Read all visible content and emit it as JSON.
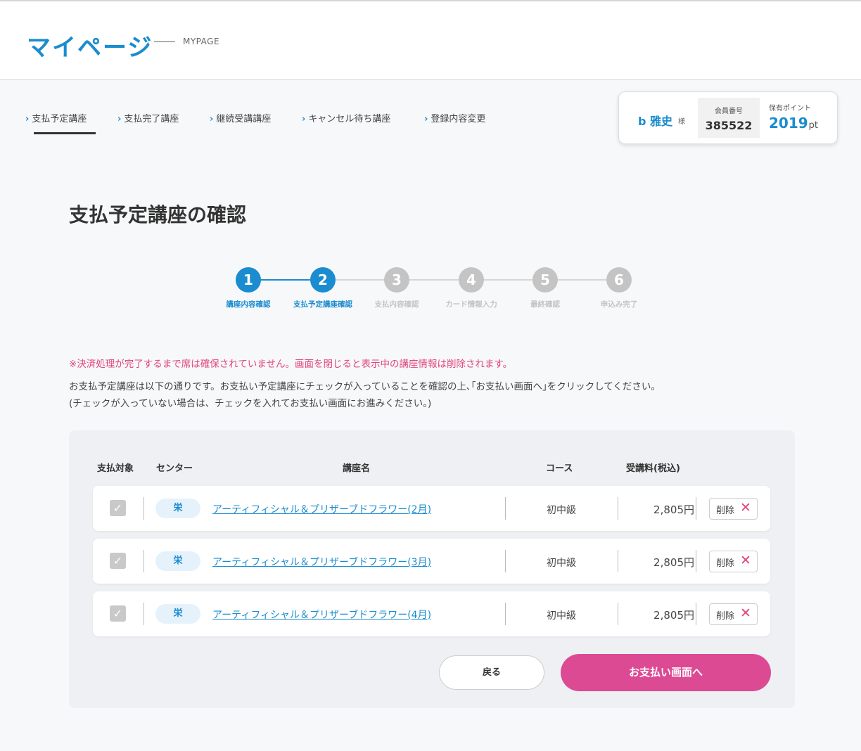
{
  "header": {
    "title": "マイページ",
    "title_en": "MYPAGE"
  },
  "nav": {
    "items": [
      {
        "label": "支払予定講座"
      },
      {
        "label": "支払完了講座"
      },
      {
        "label": "継続受講講座"
      },
      {
        "label": "キャンセル待ち講座"
      },
      {
        "label": "登録内容変更"
      }
    ],
    "chevron": "›"
  },
  "user": {
    "name": "b 雅史",
    "honorific": "様",
    "member_label": "会員番号",
    "member_number": "385522",
    "points_label": "保有ポイント",
    "points_value": "2019",
    "points_unit": "pt"
  },
  "section_title": "支払予定講座の確認",
  "steps": [
    {
      "number": "1",
      "label": "講座内容確認",
      "state": "done"
    },
    {
      "number": "2",
      "label": "支払予定講座確認",
      "state": "current"
    },
    {
      "number": "3",
      "label": "支払内容確認",
      "state": "pending"
    },
    {
      "number": "4",
      "label": "カード情報入力",
      "state": "pending"
    },
    {
      "number": "5",
      "label": "最終確認",
      "state": "pending"
    },
    {
      "number": "6",
      "label": "申込み完了",
      "state": "pending"
    }
  ],
  "messages": {
    "warning": "※決済処理が完了するまで席は確保されていません。画面を閉じると表示中の講座情報は削除されます。",
    "desc_line1": "お支払予定講座は以下の通りです。お支払い予定講座にチェックが入っていることを確認の上､｢お支払い画面へ｣をクリックしてください。",
    "desc_line2": "(チェックが入っていない場合は、チェックを入れてお支払い画面にお進みください。)"
  },
  "table": {
    "headers": {
      "target": "支払対象",
      "center": "センター",
      "course": "講座名",
      "level": "コース",
      "fee": "受講料(税込)"
    },
    "rows": [
      {
        "checked": true,
        "check_mark": "✓",
        "center": "栄",
        "course": "アーティフィシャル＆プリザーブドフラワー(2月)",
        "level": "初中級",
        "fee": "2,805円",
        "delete_label": "削除",
        "delete_icon": "✕"
      },
      {
        "checked": true,
        "check_mark": "✓",
        "center": "栄",
        "course": "アーティフィシャル＆プリザーブドフラワー(3月)",
        "level": "初中級",
        "fee": "2,805円",
        "delete_label": "削除",
        "delete_icon": "✕"
      },
      {
        "checked": true,
        "check_mark": "✓",
        "center": "栄",
        "course": "アーティフィシャル＆プリザーブドフラワー(4月)",
        "level": "初中級",
        "fee": "2,805円",
        "delete_label": "削除",
        "delete_icon": "✕"
      }
    ]
  },
  "buttons": {
    "back": "戻る",
    "pay": "お支払い画面へ"
  },
  "colors": {
    "accent": "#1a8ccf",
    "pink": "#dc4a94",
    "warning": "#e0457b",
    "inactive": "#c4c4c4"
  }
}
